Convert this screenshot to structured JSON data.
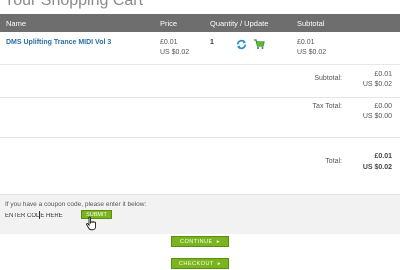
{
  "page": {
    "title": "Your Shopping Cart"
  },
  "header": {
    "name": "Name",
    "price": "Price",
    "quantity": "Quantity / Update",
    "subtotal": "Subtotal"
  },
  "item": {
    "name": "DMS Uplifting Trance MIDI Vol 3",
    "price_gbp": "£0.01",
    "price_usd": "US $0.02",
    "quantity": "1",
    "subtotal_gbp": "£0.01",
    "subtotal_usd": "US $0.02"
  },
  "totals": {
    "subtotal_label": "Subtotal:",
    "subtotal_gbp": "£0.01",
    "subtotal_usd": "US $0.02",
    "tax_label": "Tax Total:",
    "tax_gbp": "£0.00",
    "tax_usd": "US $0.00",
    "total_label": "Total:",
    "total_gbp": "£0.01",
    "total_usd": "US $0.02"
  },
  "coupon": {
    "prompt": "If you have a coupon code, please enter it below:",
    "value": "ENTER CODE HERE",
    "submit_label": "SUBMIT"
  },
  "actions": {
    "continue_label": "CONTINUE",
    "checkout_label": "CHECKOUT",
    "arrow": "▸"
  },
  "colors": {
    "header_bg": "#6e6e6e",
    "link": "#2a6fa8",
    "button_green": "#7ab51d"
  }
}
